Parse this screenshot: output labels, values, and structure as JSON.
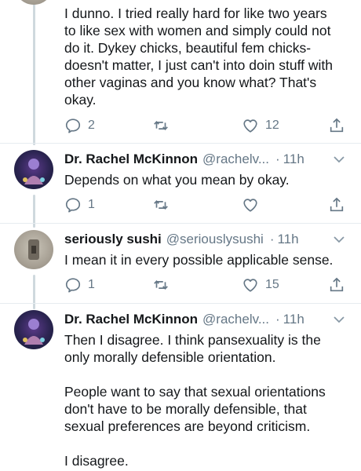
{
  "tweets": [
    {
      "lines": [
        "I dunno. I tried really hard for like two years",
        "to like sex with women and simply could not",
        "do it. Dykey chicks, beautiful fem chicks-",
        "doesn't matter, I just can't into doin stuff with",
        "other vaginas and you know what? That's",
        "okay."
      ],
      "reply_count": "2",
      "retweet_count": "",
      "like_count": "12"
    },
    {
      "name": "Dr. Rachel McKinnon",
      "handle": "@rachelv...",
      "time": "11h",
      "lines": [
        "Depends on what you mean by okay."
      ],
      "reply_count": "1",
      "retweet_count": "",
      "like_count": ""
    },
    {
      "name": "seriously sushi",
      "handle": "@seriouslysushi",
      "time": "11h",
      "lines": [
        "I mean it in every possible applicable sense."
      ],
      "reply_count": "1",
      "retweet_count": "",
      "like_count": "15"
    },
    {
      "name": "Dr. Rachel McKinnon",
      "handle": "@rachelv...",
      "time": "11h",
      "paragraphs": [
        [
          "Then I disagree. I think pansexuality is the",
          "only morally defensible orientation."
        ],
        [
          "People want to say that sexual orientations",
          "don't have to be morally defensible, that",
          "sexual preferences are beyond criticism."
        ],
        [
          "I disagree."
        ]
      ]
    }
  ],
  "icons": {
    "reply": "reply-icon",
    "retweet": "retweet-icon",
    "like": "heart-icon",
    "share": "share-icon",
    "more": "chevron-down-icon"
  },
  "colors": {
    "text": "#14171a",
    "secondary": "#657786",
    "thread_line": "#cfd9de",
    "divider": "#e6ecf0"
  }
}
